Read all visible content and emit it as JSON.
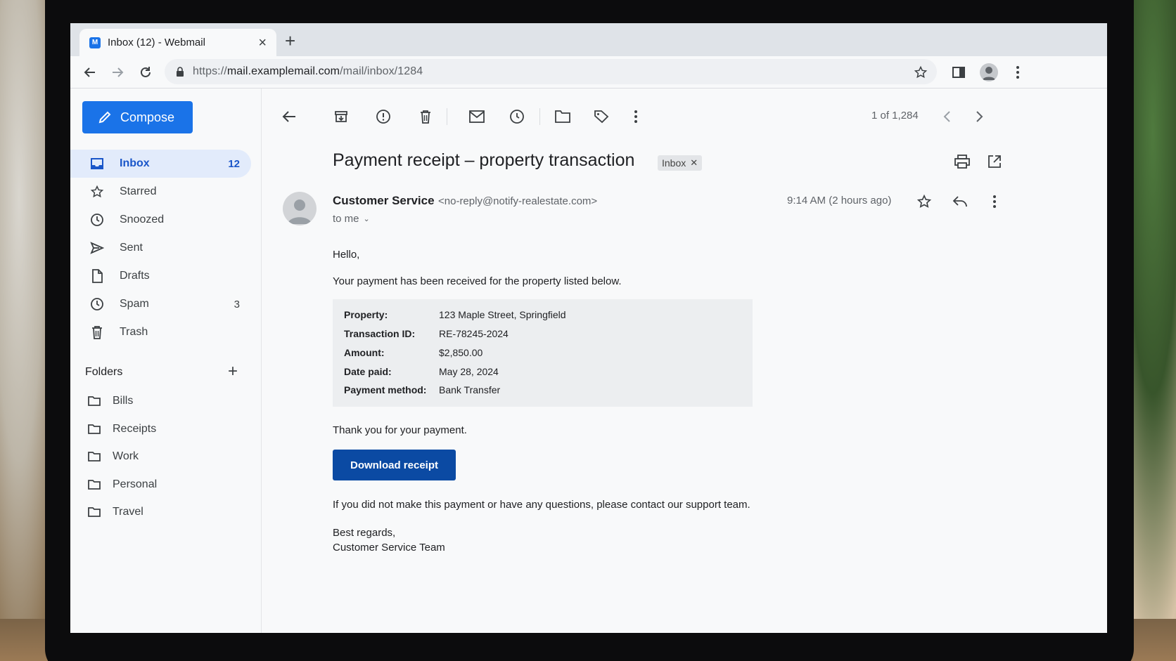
{
  "browser": {
    "tab_title": "Inbox (12) - Webmail",
    "tab_favicon": "M",
    "url_prefix": "https://",
    "url_host": "mail.examplemail.com",
    "url_path": "/mail/inbox/1284"
  },
  "sidebar": {
    "compose_label": "Compose",
    "items": [
      {
        "label": "Inbox",
        "count": "12",
        "icon": "inbox-icon"
      },
      {
        "label": "Starred",
        "count": "",
        "icon": "star-icon"
      },
      {
        "label": "Snoozed",
        "count": "",
        "icon": "clock-icon"
      },
      {
        "label": "Sent",
        "count": "",
        "icon": "send-icon"
      },
      {
        "label": "Drafts",
        "count": "",
        "icon": "draft-icon"
      },
      {
        "label": "Spam",
        "count": "3",
        "icon": "clock-icon"
      },
      {
        "label": "Trash",
        "count": "",
        "icon": "trash-icon"
      }
    ],
    "folders_heading": "Folders",
    "folders": [
      "Bills",
      "Receipts",
      "Work",
      "Personal",
      "Travel"
    ]
  },
  "toolbar": {
    "pager": "1 of 1,284"
  },
  "message": {
    "subject": "Payment receipt – property transaction",
    "label": "Inbox",
    "sender_name": "Customer Service",
    "sender_email": "<no-reply@notify-realestate.com>",
    "to": "to me",
    "time": "9:14 AM (2 hours ago)",
    "greeting": "Hello,",
    "intro": "Your payment has been received for the property listed below.",
    "details": [
      {
        "key": "Property:",
        "value": "123 Maple Street, Springfield"
      },
      {
        "key": "Transaction ID:",
        "value": "RE-78245-2024"
      },
      {
        "key": "Amount:",
        "value": "$2,850.00"
      },
      {
        "key": "Date paid:",
        "value": "May 28, 2024"
      },
      {
        "key": "Payment method:",
        "value": "Bank Transfer"
      }
    ],
    "thanks": "Thank you for your payment.",
    "button_label": "Download receipt",
    "notice": "If you did not make this payment or have any questions, please contact our support team.",
    "signoff": "Best regards,",
    "signature": "Customer Service Team"
  },
  "colors": {
    "accent": "#1a73e8",
    "button": "#0b4aa3",
    "active_nav_bg": "#e2ebfb"
  }
}
